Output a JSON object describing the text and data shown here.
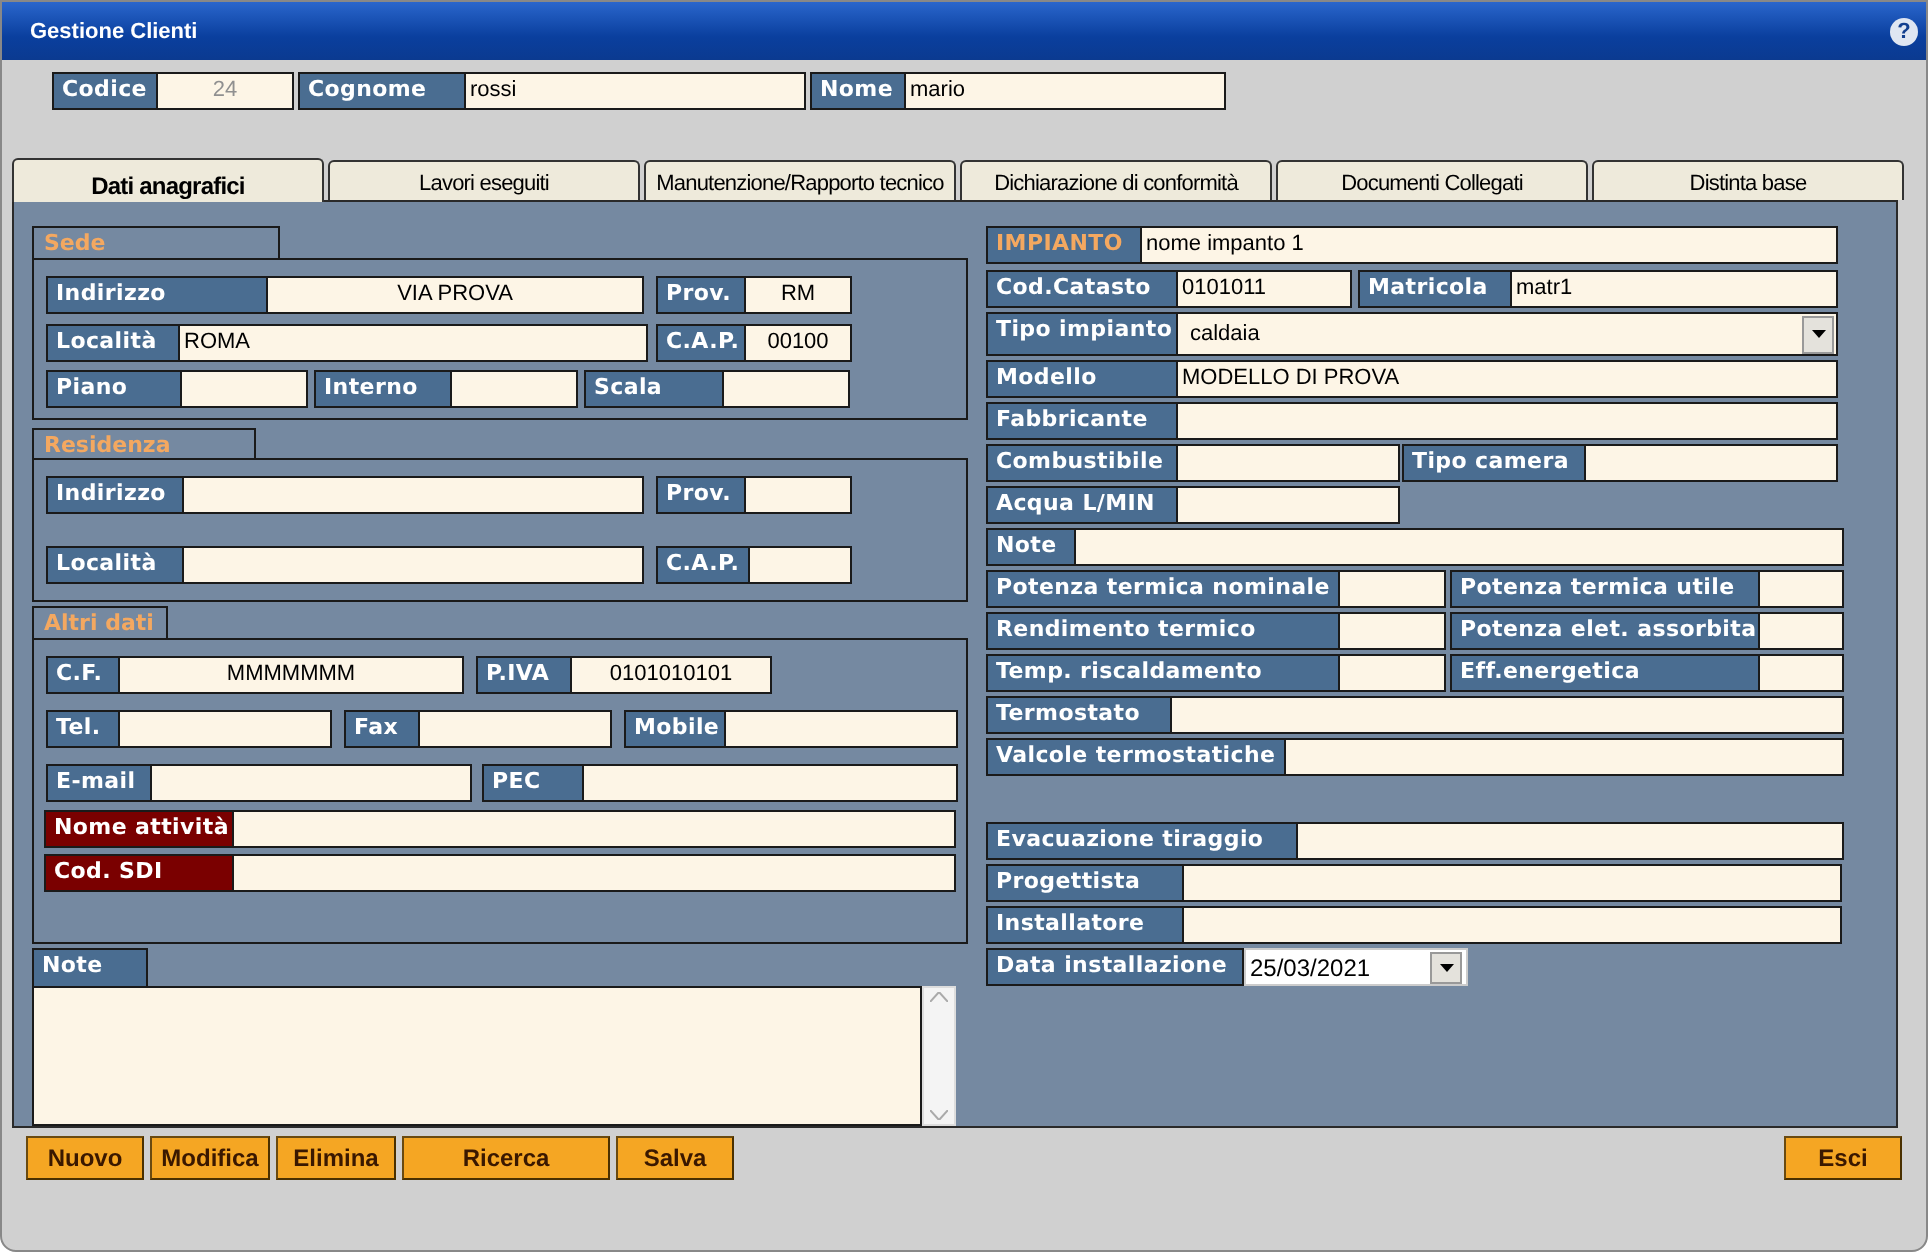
{
  "window": {
    "title": "Gestione Clienti",
    "help": "?"
  },
  "header_fields": [
    {
      "label": "Codice",
      "value": "24",
      "disabled": true
    },
    {
      "label": "Cognome",
      "value": "rossi",
      "disabled": false
    },
    {
      "label": "Nome",
      "value": "mario",
      "disabled": false
    }
  ],
  "tabs": [
    {
      "label": "Dati anagrafici",
      "selected": true
    },
    {
      "label": "Lavori eseguiti",
      "selected": false
    },
    {
      "label": "Manutenzione/Rapporto tecnico",
      "selected": false
    },
    {
      "label": "Dichiarazione di conformità",
      "selected": false
    },
    {
      "label": "Documenti Collegati",
      "selected": false
    },
    {
      "label": "Distinta base",
      "selected": false
    }
  ],
  "left_sections": [
    {
      "title": "Sede",
      "rows": [
        [
          {
            "label": "Indirizzo",
            "value": "VIA PROVA"
          },
          {
            "label": "Prov.",
            "value": "RM"
          }
        ],
        [
          {
            "label": "Località",
            "value": "ROMA"
          },
          {
            "label": "C.A.P.",
            "value": "00100"
          }
        ],
        [
          {
            "label": "Piano"
          },
          {
            "label": "Interno"
          },
          {
            "label": "Scala"
          }
        ]
      ]
    },
    {
      "title": "Residenza",
      "rows": [
        [
          {
            "label": "Indirizzo"
          },
          {
            "label": "Prov."
          }
        ],
        [
          {
            "label": "Località"
          },
          {
            "label": "C.A.P."
          }
        ]
      ]
    },
    {
      "title": "Altri dati",
      "rows": [
        [
          {
            "label": "C.F.",
            "value": "MMMMMMM",
            "required": false
          },
          {
            "label": "P.IVA",
            "value": "0101010101",
            "required": false
          }
        ],
        [
          {
            "label": "Tel.",
            "required": false
          },
          {
            "label": "Fax",
            "required": false
          },
          {
            "label": "Mobile",
            "required": false
          }
        ],
        [
          {
            "label": "E-mail",
            "required": false
          },
          {
            "label": "PEC",
            "required": false
          }
        ],
        [
          {
            "label": "Nome attività",
            "required": true
          }
        ],
        [
          {
            "label": "Cod. SDI",
            "required": true
          }
        ]
      ]
    }
  ],
  "notes": {
    "label": "Note"
  },
  "plant": {
    "title": "IMPIANTO",
    "name": "nome impanto 1",
    "rows": [
      [
        {
          "kind": "text",
          "label": "Cod.Catasto",
          "value": "0101011"
        },
        {
          "kind": "text",
          "label": "Matricola",
          "value": "matr1"
        }
      ],
      [
        {
          "kind": "select",
          "label": "Tipo impianto",
          "value": "caldaia"
        }
      ],
      [
        {
          "kind": "text",
          "label": "Modello",
          "value": "MODELLO DI PROVA"
        }
      ],
      [
        {
          "kind": "text",
          "label": "Fabbricante"
        }
      ],
      [
        {
          "kind": "text",
          "label": "Combustibile"
        },
        {
          "kind": "text",
          "label": "Tipo camera"
        }
      ],
      [
        {
          "kind": "text",
          "label": "Acqua L/MIN"
        }
      ],
      [
        {
          "kind": "text",
          "label": "Note"
        }
      ],
      [
        {
          "kind": "text",
          "label": "Potenza termica nominale"
        },
        {
          "kind": "text",
          "label": "Potenza termica utile"
        }
      ],
      [
        {
          "kind": "text",
          "label": "Rendimento termico"
        },
        {
          "kind": "text",
          "label": "Potenza elet. assorbita"
        }
      ],
      [
        {
          "kind": "text",
          "label": "Temp. riscaldamento"
        },
        {
          "kind": "text",
          "label": "Eff.energetica"
        }
      ],
      [
        {
          "kind": "text",
          "label": "Termostato"
        }
      ],
      [
        {
          "kind": "text",
          "label": "Valcole termostatiche"
        }
      ],
      [
        {
          "kind": "text",
          "label": "Evacuazione tiraggio"
        }
      ],
      [
        {
          "kind": "text",
          "label": "Progettista"
        }
      ],
      [
        {
          "kind": "text",
          "label": "Installatore"
        }
      ],
      [
        {
          "kind": "date",
          "label": "Data installazione",
          "value": "25/03/2021"
        }
      ]
    ]
  },
  "buttons": [
    {
      "label": "Nuovo"
    },
    {
      "label": "Modifica"
    },
    {
      "label": "Elimina"
    },
    {
      "label": "Ricerca"
    },
    {
      "label": "Salva"
    }
  ],
  "exit_button": {
    "label": "Esci"
  }
}
